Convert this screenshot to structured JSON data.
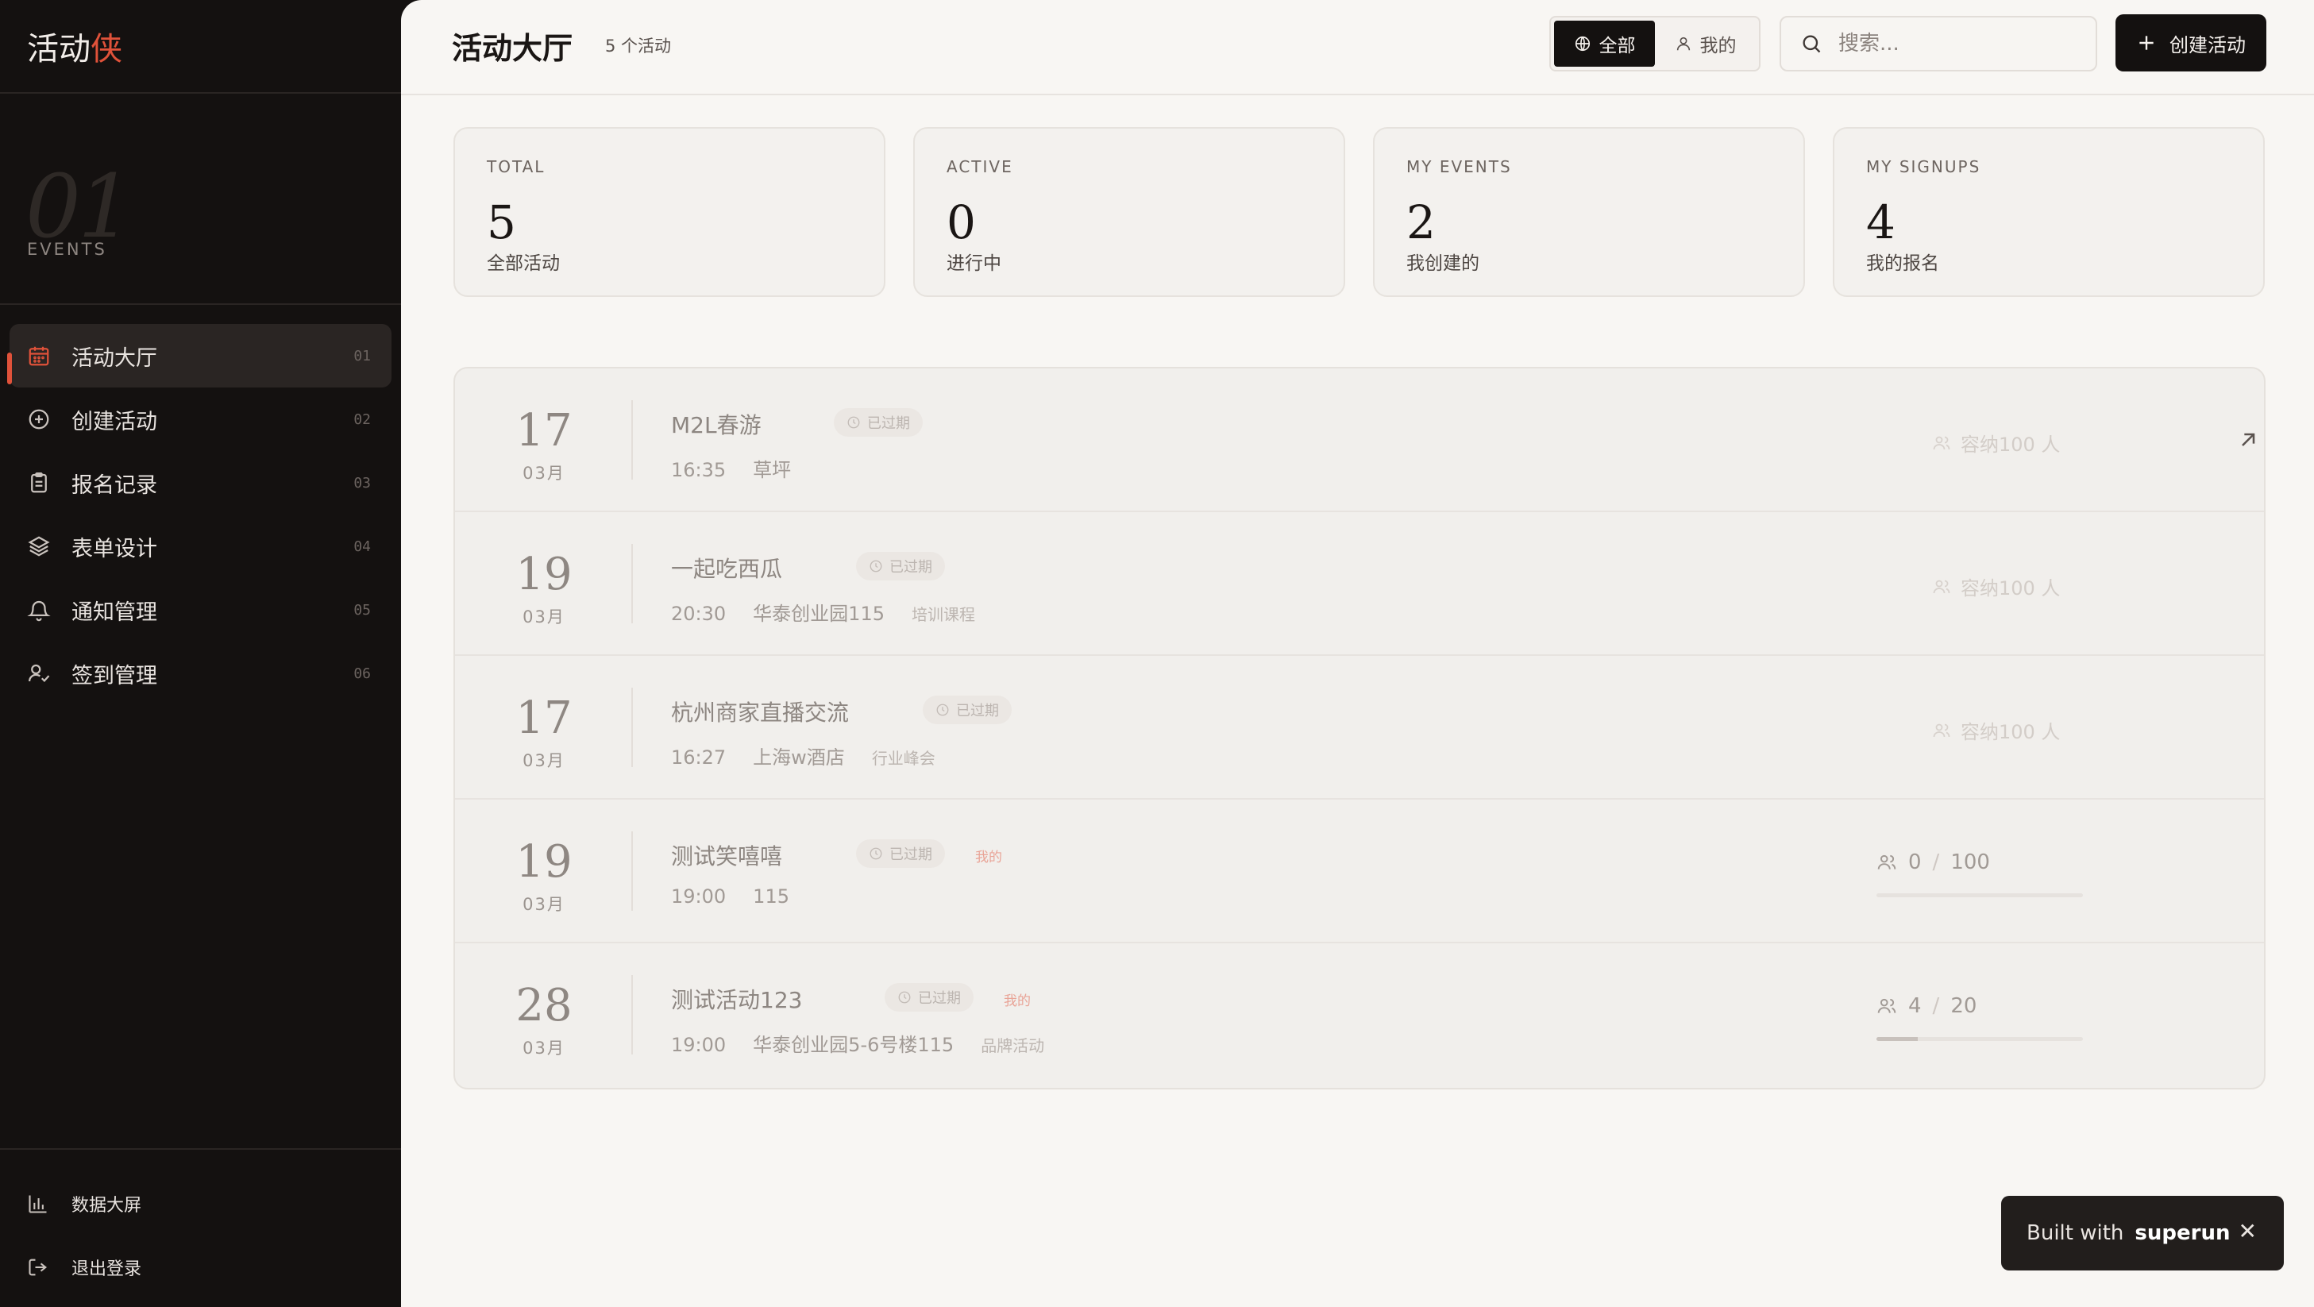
{
  "brand": {
    "main": "活动",
    "accent": "侠"
  },
  "sidebar": {
    "big_number": "01",
    "big_label": "EVENTS",
    "items": [
      {
        "label": "活动大厅",
        "num": "01",
        "icon": "calendar-icon",
        "active": true
      },
      {
        "label": "创建活动",
        "num": "02",
        "icon": "plus-circle-icon",
        "active": false
      },
      {
        "label": "报名记录",
        "num": "03",
        "icon": "clipboard-icon",
        "active": false
      },
      {
        "label": "表单设计",
        "num": "04",
        "icon": "layers-icon",
        "active": false
      },
      {
        "label": "通知管理",
        "num": "05",
        "icon": "bell-icon",
        "active": false
      },
      {
        "label": "签到管理",
        "num": "06",
        "icon": "user-check-icon",
        "active": false
      }
    ],
    "footer": [
      {
        "label": "数据大屏",
        "icon": "bar-chart-icon"
      },
      {
        "label": "退出登录",
        "icon": "logout-icon"
      }
    ]
  },
  "header": {
    "title": "活动大厅",
    "count": "5 个活动",
    "seg_all": "全部",
    "seg_mine": "我的",
    "search_placeholder": "搜索...",
    "create_label": "创建活动"
  },
  "stats": [
    {
      "key": "TOTAL",
      "value": "5",
      "sub": "全部活动"
    },
    {
      "key": "ACTIVE",
      "value": "0",
      "sub": "进行中"
    },
    {
      "key": "MY EVENTS",
      "value": "2",
      "sub": "我创建的"
    },
    {
      "key": "MY SIGNUPS",
      "value": "4",
      "sub": "我的报名"
    }
  ],
  "events": [
    {
      "day": "17",
      "month": "03月",
      "title": "M2L春游",
      "badge": "已过期",
      "mine": "",
      "time": "16:35",
      "place": "草坪",
      "tag": "",
      "capacity": "容纳100 人",
      "arrow": true
    },
    {
      "day": "19",
      "month": "03月",
      "title": "一起吃西瓜",
      "badge": "已过期",
      "mine": "",
      "time": "20:30",
      "place": "华泰创业园115",
      "tag": "培训课程",
      "capacity": "容纳100 人"
    },
    {
      "day": "17",
      "month": "03月",
      "title": "杭州商家直播交流",
      "badge": "已过期",
      "mine": "",
      "time": "16:27",
      "place": "上海w酒店",
      "tag": "行业峰会",
      "capacity": "容纳100 人"
    },
    {
      "day": "19",
      "month": "03月",
      "title": "测试笑嘻嘻",
      "badge": "已过期",
      "mine": "我的",
      "time": "19:00",
      "place": "115",
      "tag": "",
      "current": "0",
      "max": "100",
      "progress": 0
    },
    {
      "day": "28",
      "month": "03月",
      "title": "测试活动123",
      "badge": "已过期",
      "mine": "我的",
      "time": "19:00",
      "place": "华泰创业园5-6号楼115",
      "tag": "品牌活动",
      "current": "4",
      "max": "20",
      "progress": 0.2
    }
  ],
  "toast": {
    "prefix": "Built with",
    "brand": "superun",
    "close": "✕"
  },
  "colors": {
    "accent": "#e0523a",
    "sidebar_bg": "#141110",
    "main_bg": "#f8f6f3"
  }
}
